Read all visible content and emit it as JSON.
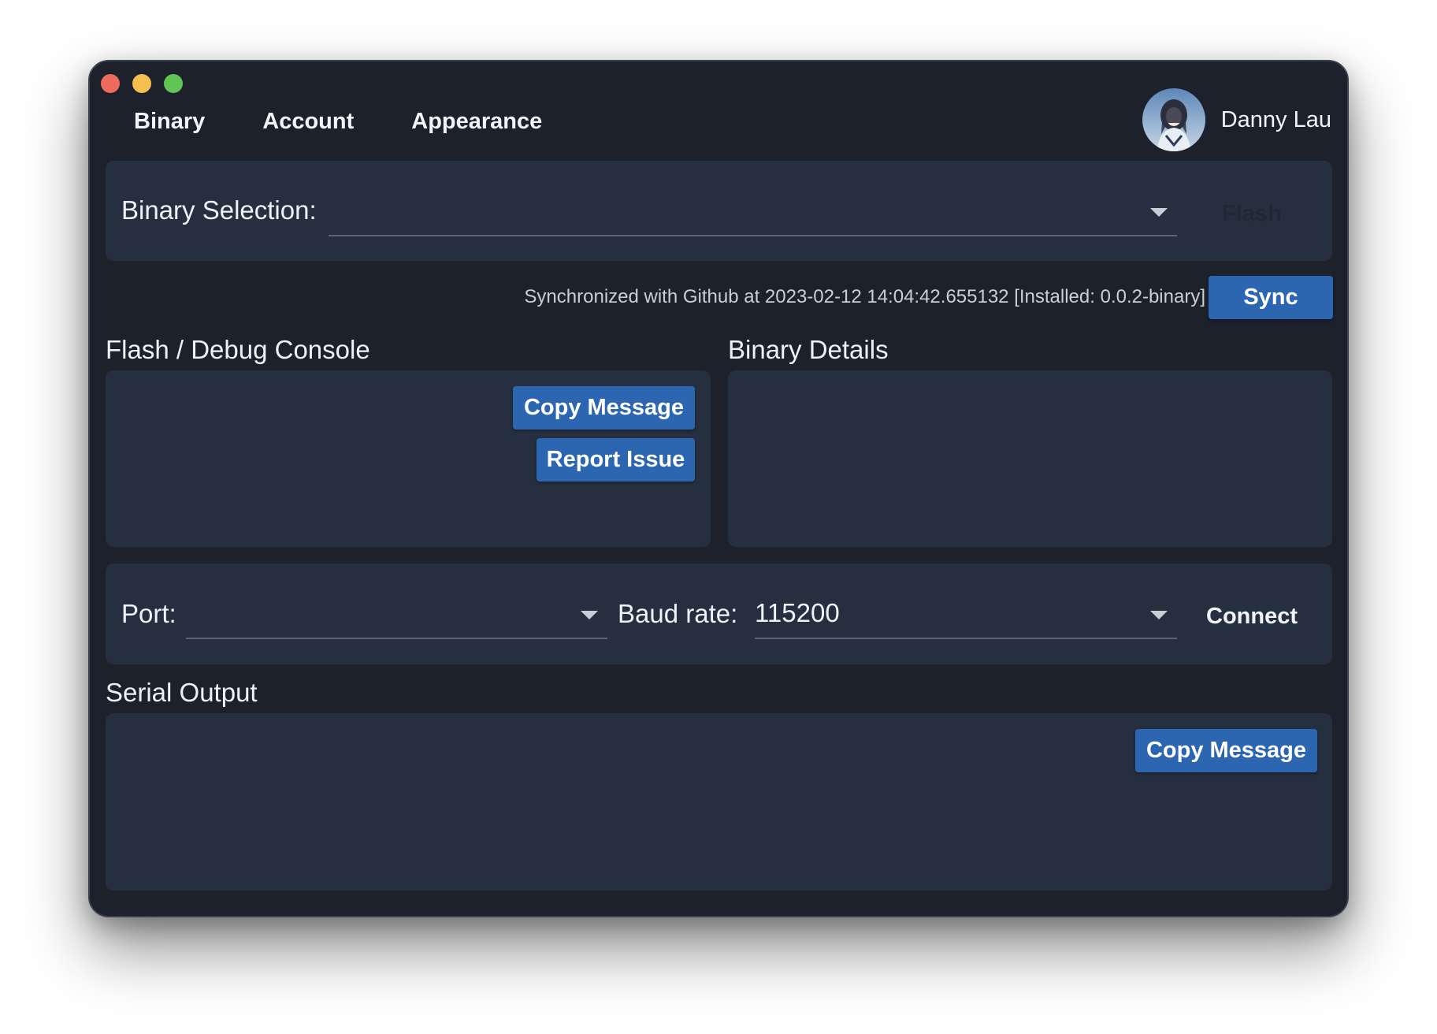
{
  "tabs": [
    {
      "label": "Binary"
    },
    {
      "label": "Account"
    },
    {
      "label": "Appearance"
    }
  ],
  "user": {
    "name": "Danny Lau"
  },
  "binary_selection": {
    "label": "Binary Selection:",
    "value": "",
    "flash_label": "Flash"
  },
  "sync": {
    "status": "Synchronized with Github at 2023-02-12 14:04:42.655132 [Installed: 0.0.2-binary]",
    "button_label": "Sync"
  },
  "flash_console": {
    "title": "Flash / Debug Console",
    "copy_label": "Copy Message",
    "report_label": "Report Issue"
  },
  "binary_details": {
    "title": "Binary Details"
  },
  "serial": {
    "port_label": "Port:",
    "port_value": "",
    "baud_label": "Baud rate:",
    "baud_value": "115200",
    "connect_label": "Connect"
  },
  "serial_output": {
    "title": "Serial Output",
    "copy_label": "Copy Message"
  },
  "colors": {
    "window_bg": "#1c212c",
    "panel_bg": "#262f40",
    "accent": "#2d66b0"
  }
}
